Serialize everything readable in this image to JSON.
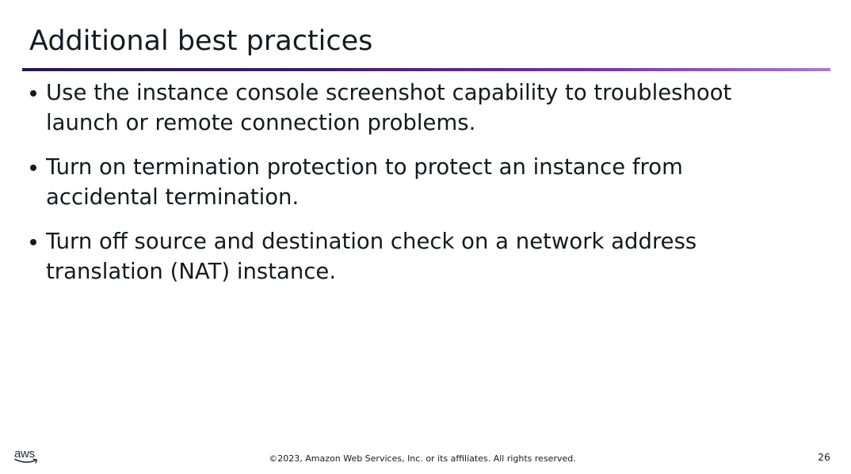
{
  "slide": {
    "title": "Additional best practices",
    "bullets": [
      "Use the instance console screenshot capability to troubleshoot launch or remote connection problems.",
      "Turn on termination protection to protect an instance from accidental termination.",
      "Turn off source and destination check on a network address translation (NAT) instance."
    ]
  },
  "footer": {
    "logo_text": "aws",
    "copyright": "©2023, Amazon Web Services, Inc. or its affiliates. All rights reserved.",
    "page_number": "26"
  },
  "colors": {
    "text": "#16191f",
    "rule_start": "#2b1650",
    "rule_end": "#a679d8",
    "logo_smile": "#232f3e"
  },
  "icons": {
    "logo": "aws-logo-icon",
    "bullet": "bullet-dot-icon"
  }
}
